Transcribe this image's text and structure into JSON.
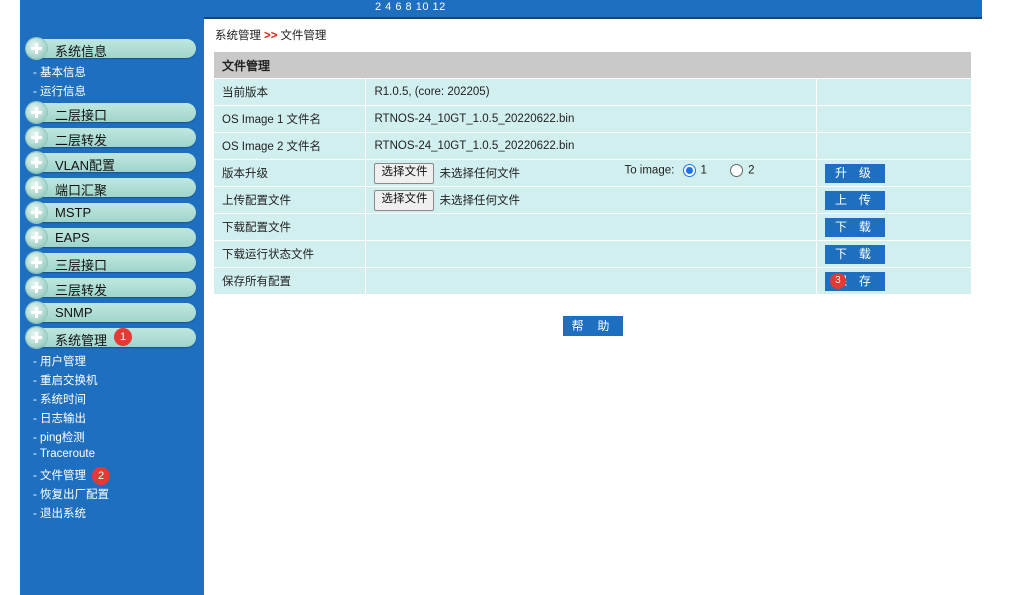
{
  "header": {
    "port_numbers": "2   4   6   8   10  12"
  },
  "sidebar": {
    "groups": [
      {
        "label": "系统信息"
      },
      {
        "label": "二层接口"
      },
      {
        "label": "二层转发"
      },
      {
        "label": "VLAN配置"
      },
      {
        "label": "端口汇聚"
      },
      {
        "label": "MSTP"
      },
      {
        "label": "EAPS"
      },
      {
        "label": "三层接口"
      },
      {
        "label": "三层转发"
      },
      {
        "label": "SNMP"
      },
      {
        "label": "系统管理"
      }
    ],
    "system_info_items": [
      "- 基本信息",
      "- 运行信息"
    ],
    "system_mgmt_items": [
      "- 用户管理",
      "- 重启交换机",
      "- 系统时间",
      "- 日志输出",
      "- ping检测",
      "- Traceroute",
      "- 文件管理",
      "- 恢复出厂配置",
      "- 退出系统"
    ]
  },
  "badges": [
    "1",
    "2",
    "3"
  ],
  "breadcrumb": {
    "parent": "系统管理",
    "separator": ">>",
    "current": "文件管理"
  },
  "table": {
    "title": "文件管理",
    "rows": {
      "current_version": {
        "label": "当前版本",
        "value": "R1.0.5, (core: 202205)"
      },
      "os_image1": {
        "label": "OS Image 1 文件名",
        "value": "RTNOS-24_10GT_1.0.5_20220622.bin"
      },
      "os_image2": {
        "label": "OS Image 2 文件名",
        "value": "RTNOS-24_10GT_1.0.5_20220622.bin"
      },
      "upgrade": {
        "label": "版本升级",
        "choose_file": "选择文件",
        "no_file": "未选择任何文件",
        "to_image": "To image:",
        "option1": "1",
        "option2": "2",
        "selected": "1",
        "button": "升 级"
      },
      "upload_config": {
        "label": "上传配置文件",
        "choose_file": "选择文件",
        "no_file": "未选择任何文件",
        "button": "上 传"
      },
      "download_config": {
        "label": "下载配置文件",
        "button": "下 载"
      },
      "download_running": {
        "label": "下载运行状态文件",
        "button": "下 载"
      },
      "save_all": {
        "label": "保存所有配置",
        "button": "保 存"
      }
    }
  },
  "help_button": "帮 助",
  "colors": {
    "nav_blue": "#1e6fbf",
    "row_bg": "#d2eff0",
    "header_bg": "#c9c9c9",
    "badge_red": "#e53935"
  }
}
